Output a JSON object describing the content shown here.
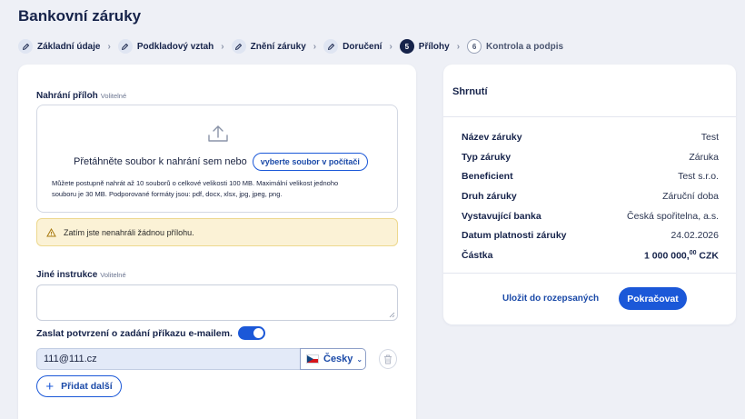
{
  "page": {
    "title": "Bankovní záruky"
  },
  "steps": [
    {
      "label": "Základní údaje",
      "state": "done"
    },
    {
      "label": "Podkladový vztah",
      "state": "done"
    },
    {
      "label": "Znění záruky",
      "state": "done"
    },
    {
      "label": "Doručení",
      "state": "done"
    },
    {
      "number": "5",
      "label": "Přílohy",
      "state": "current"
    },
    {
      "number": "6",
      "label": "Kontrola a podpis",
      "state": "future"
    }
  ],
  "attachments": {
    "label": "Nahrání příloh",
    "optional": "Volitelné",
    "drop_text": "Přetáhněte soubor k nahrání sem nebo",
    "pick_button": "vyberte soubor v počítači",
    "help": "Můžete postupně nahrát až 10 souborů o celkové velikosti 100 MB. Maximální velikost jednoho souboru je 30 MB. Podporované formáty jsou: pdf, docx, xlsx, jpg, jpeg, png.",
    "warning": "Zatím jste nenahráli žádnou přílohu."
  },
  "instructions": {
    "label": "Jiné instrukce",
    "optional": "Volitelné",
    "value": ""
  },
  "email_confirm": {
    "label": "Zaslat potvrzení o zadání příkazu e-mailem.",
    "enabled": true,
    "email": "111@111.cz",
    "language": "Česky",
    "add_label": "Přidat další"
  },
  "summary": {
    "title": "Shrnutí",
    "rows": [
      {
        "key": "Název záruky",
        "value": "Test"
      },
      {
        "key": "Typ záruky",
        "value": "Záruka"
      },
      {
        "key": "Beneficient",
        "value": "Test s.r.o."
      },
      {
        "key": "Druh záruky",
        "value": "Záruční doba"
      },
      {
        "key": "Vystavující banka",
        "value": "Česká spořitelna, a.s."
      },
      {
        "key": "Datum platnosti záruky",
        "value": "24.02.2026"
      }
    ],
    "amount": {
      "key": "Částka",
      "value_main": "1 000 000,",
      "value_sup": "00",
      "currency": "CZK"
    },
    "save_label": "Uložit do rozepsaných",
    "continue_label": "Pokračovat"
  },
  "colors": {
    "accent": "#1b58d8",
    "navy": "#16234a",
    "warning_bg": "#fbf2d6"
  }
}
